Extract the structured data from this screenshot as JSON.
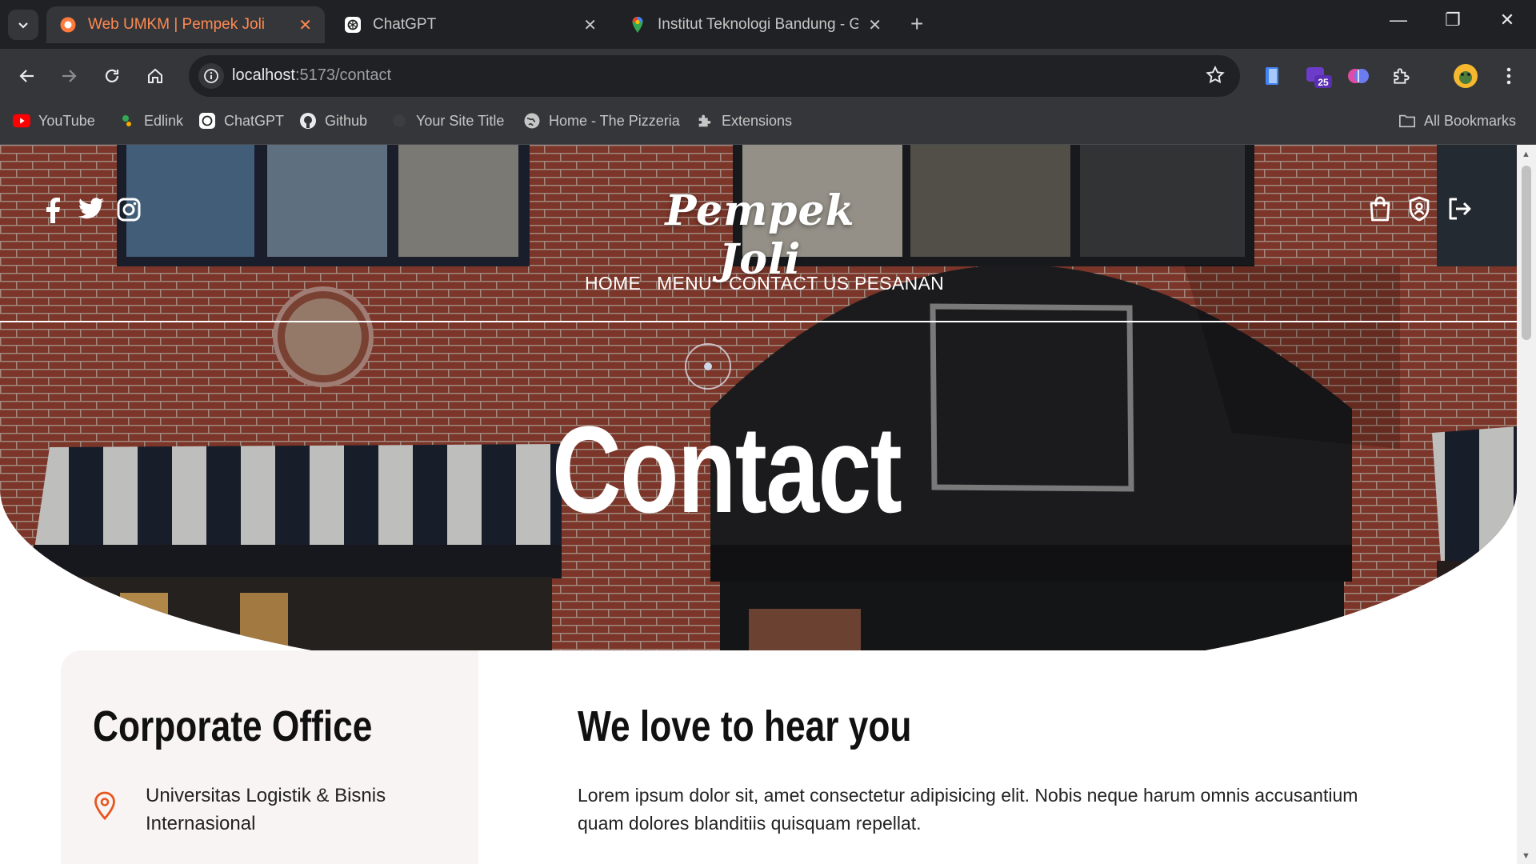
{
  "browser": {
    "tabs": [
      {
        "title": "Web UMKM | Pempek Joli",
        "active": true
      },
      {
        "title": "ChatGPT",
        "active": false
      },
      {
        "title": "Institut Teknologi Bandung - Go",
        "active": false
      }
    ],
    "new_tab": "+",
    "window_controls": {
      "minimize": "—",
      "restore": "❐",
      "close": "✕"
    },
    "url_host": "localhost",
    "url_path": ":5173/contact",
    "extension_badge": "25",
    "bookmarks": [
      {
        "label": "YouTube",
        "icon": "youtube-icon"
      },
      {
        "label": "Edlink",
        "icon": "edlink-icon"
      },
      {
        "label": "ChatGPT",
        "icon": "chatgpt-icon"
      },
      {
        "label": "Github",
        "icon": "github-icon"
      },
      {
        "label": "Your Site Title",
        "icon": "site-icon"
      },
      {
        "label": "Home - The Pizzeria",
        "icon": "globe-icon"
      },
      {
        "label": "Extensions",
        "icon": "puzzle-icon"
      }
    ],
    "all_bookmarks": "All Bookmarks"
  },
  "site": {
    "brand": "Pempek Joli",
    "nav": [
      "HOME",
      "MENU",
      "CONTACT US",
      "PESANAN"
    ],
    "social_icons": [
      "facebook-icon",
      "twitter-icon",
      "instagram-icon"
    ],
    "action_icons": [
      "shopping-bag-icon",
      "admin-shield-icon",
      "logout-icon"
    ],
    "hero_title": "Contact",
    "office": {
      "title": "Corporate Office",
      "address_line1": "Universitas Logistik & Bisnis",
      "address_line2": "Internasional"
    },
    "message": {
      "title": "We love to hear you",
      "body_line1": "Lorem ipsum dolor sit, amet consectetur adipisicing elit. Nobis neque harum omnis accusantium",
      "body_line2": "quam dolores blanditiis quisquam repellat."
    }
  },
  "colors": {
    "accent_tab": "#ff8a50",
    "pin_orange": "#e8551f",
    "chrome_dark": "#202124",
    "chrome_mid": "#35363a"
  }
}
